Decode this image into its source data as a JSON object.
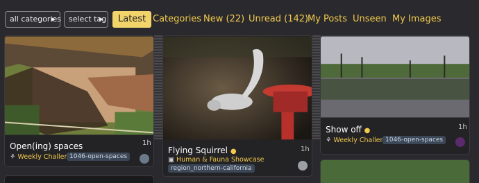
{
  "filters": {
    "categories": "all categories",
    "tags": "select tag"
  },
  "nav": [
    "Latest",
    "Categories",
    "New (22)",
    "Unread (142)",
    "My Posts",
    "Unseen",
    "My Images"
  ],
  "cards": [
    {
      "title": "Open(ing) spaces",
      "age": "1h",
      "category": "Weekly Challenge",
      "tag": "1046-open-spaces"
    },
    {
      "title": "Flying Squirrel",
      "age": "1h",
      "category": "Human & Fauna Showcase",
      "tag": "region_northern-california"
    },
    {
      "title": "Show off",
      "age": "1h",
      "category": "Weekly Challenge",
      "tag": "1046-open-spaces"
    }
  ],
  "colors": {
    "accent": "#f3d46b",
    "link": "#f2c94c",
    "background": "#2a2a2e"
  }
}
